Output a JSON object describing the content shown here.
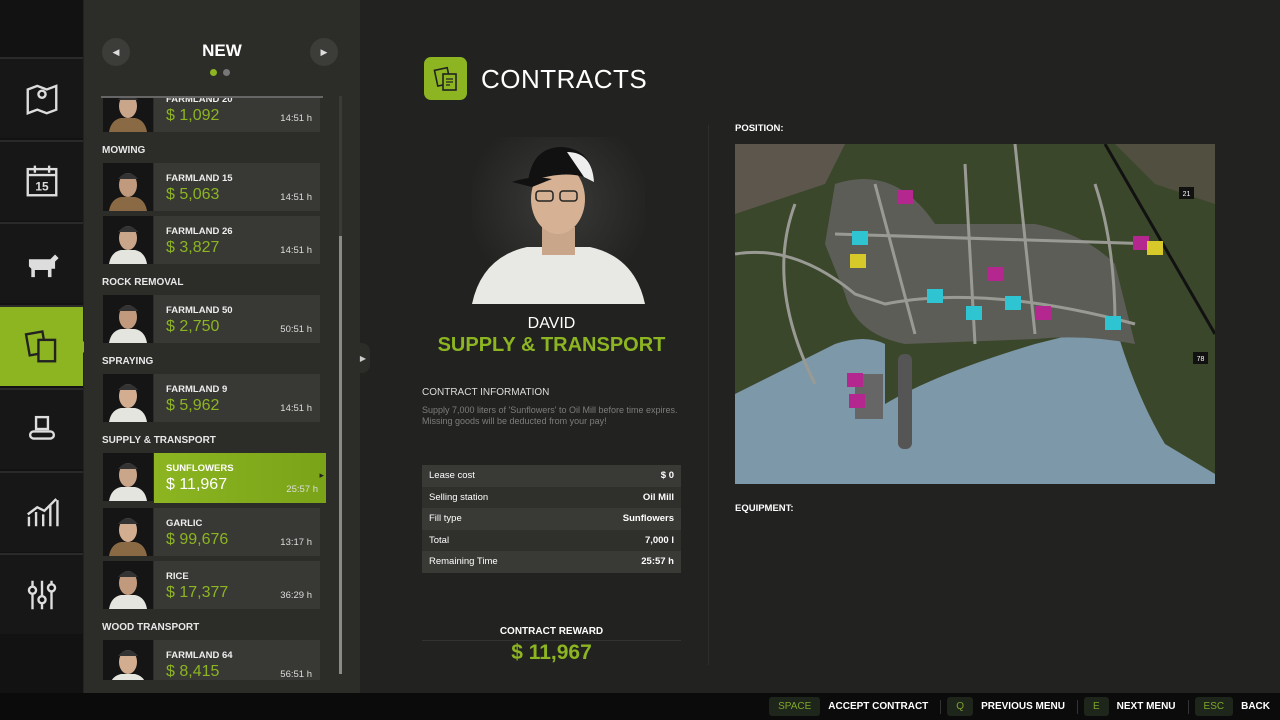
{
  "sidebar": {
    "items": [
      {
        "icon": "map-icon"
      },
      {
        "icon": "calendar-icon",
        "label": "15"
      },
      {
        "icon": "animals-icon"
      },
      {
        "icon": "contracts-icon",
        "active": true
      },
      {
        "icon": "production-icon"
      },
      {
        "icon": "statistics-icon"
      },
      {
        "icon": "settings-icon"
      }
    ]
  },
  "panel": {
    "title": "NEW",
    "pages": 2,
    "current_page": 1
  },
  "list": [
    {
      "type": "item",
      "name": "FARMLAND 20",
      "price": "$ 1,092",
      "time": "14:51 h"
    },
    {
      "type": "header",
      "label": "MOWING"
    },
    {
      "type": "item",
      "name": "FARMLAND 15",
      "price": "$ 5,063",
      "time": "14:51 h"
    },
    {
      "type": "item",
      "name": "FARMLAND 26",
      "price": "$ 3,827",
      "time": "14:51 h"
    },
    {
      "type": "header",
      "label": "ROCK REMOVAL"
    },
    {
      "type": "item",
      "name": "FARMLAND 50",
      "price": "$ 2,750",
      "time": "50:51 h"
    },
    {
      "type": "header",
      "label": "SPRAYING"
    },
    {
      "type": "item",
      "name": "FARMLAND 9",
      "price": "$ 5,962",
      "time": "14:51 h"
    },
    {
      "type": "header",
      "label": "SUPPLY & TRANSPORT"
    },
    {
      "type": "item",
      "name": "SUNFLOWERS",
      "price": "$ 11,967",
      "time": "25:57 h",
      "selected": true
    },
    {
      "type": "item",
      "name": "GARLIC",
      "price": "$ 99,676",
      "time": "13:17 h"
    },
    {
      "type": "item",
      "name": "RICE",
      "price": "$ 17,377",
      "time": "36:29 h"
    },
    {
      "type": "header",
      "label": "WOOD TRANSPORT"
    },
    {
      "type": "item",
      "name": "FARMLAND 64",
      "price": "$ 8,415",
      "time": "56:51 h"
    }
  ],
  "main": {
    "title": "CONTRACTS",
    "npc_name": "DAVID",
    "npc_role": "SUPPLY & TRANSPORT",
    "info_header": "CONTRACT INFORMATION",
    "info_text": "Supply 7,000 liters of 'Sunflowers' to Oil Mill before time expires. Missing goods will be deducted from your pay!",
    "details": [
      {
        "label": "Lease cost",
        "value": "$ 0"
      },
      {
        "label": "Selling station",
        "value": "Oil Mill"
      },
      {
        "label": "Fill type",
        "value": "Sunflowers"
      },
      {
        "label": "Total",
        "value": "7,000 l"
      },
      {
        "label": "Remaining Time",
        "value": "25:57 h"
      }
    ],
    "reward_label": "CONTRACT REWARD",
    "reward_value": "$ 11,967",
    "position_label": "POSITION:",
    "equipment_label": "EQUIPMENT:",
    "map_labels": [
      "21",
      "78"
    ]
  },
  "hints": [
    {
      "key": "SPACE",
      "label": "ACCEPT CONTRACT"
    },
    {
      "key": "Q",
      "label": "PREVIOUS MENU"
    },
    {
      "key": "E",
      "label": "NEXT MENU"
    },
    {
      "key": "ESC",
      "label": "BACK"
    }
  ],
  "colors": {
    "accent": "#8cb521",
    "background": "#222221",
    "panel": "#2c2c29"
  }
}
